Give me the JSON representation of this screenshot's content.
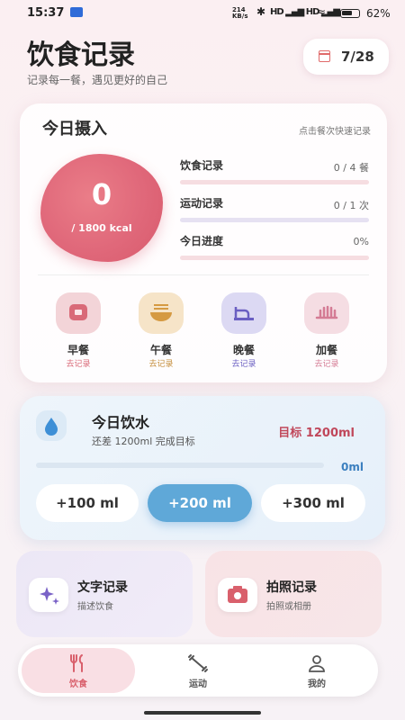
{
  "status": {
    "time": "15:37",
    "net_top": "214",
    "net_bottom": "KB/s",
    "battery": "62%",
    "bluetooth": "✱",
    "signal": "HD ▂▄▆ HD ▂▄▆",
    "wifi": "≈"
  },
  "header": {
    "title": "饮食记录",
    "subtitle": "记录每一餐，遇见更好的自己",
    "date": "7/28"
  },
  "intake": {
    "title": "今日摄入",
    "hint": "点击餐次快速记录",
    "calories": "0",
    "calorie_target": "/ 1800 kcal",
    "rows": [
      {
        "label": "饮食记录",
        "value": "0 / 4 餐"
      },
      {
        "label": "运动记录",
        "value": "0 / 1 次"
      },
      {
        "label": "今日进度",
        "value": "0%"
      }
    ],
    "meals": [
      {
        "name": "早餐",
        "action": "去记录",
        "icon": "toast-icon",
        "color": "#f3d4d8",
        "accent": "#d96a78"
      },
      {
        "name": "午餐",
        "action": "去记录",
        "icon": "noodle-bowl-icon",
        "color": "#f6e4c8",
        "accent": "#d59a42"
      },
      {
        "name": "晚餐",
        "action": "去记录",
        "icon": "dinner-plate-icon",
        "color": "#dcd9f3",
        "accent": "#6a5fc2"
      },
      {
        "name": "加餐",
        "action": "去记录",
        "icon": "snack-icon",
        "color": "#f5dde3",
        "accent": "#d47b94"
      }
    ]
  },
  "water": {
    "title": "今日饮水",
    "subtitle": "还差 1200ml 完成目标",
    "goal": "目标 1200ml",
    "current": "0ml",
    "progress": 0,
    "buttons": [
      "+100 ml",
      "+200 ml",
      "+300 ml"
    ]
  },
  "quick": [
    {
      "title": "文字记录",
      "desc": "描述饮食",
      "icon": "sparkle-icon"
    },
    {
      "title": "拍照记录",
      "desc": "拍照或相册",
      "icon": "camera-icon"
    }
  ],
  "nav": [
    {
      "label": "饮食",
      "icon": "fork-knife-icon"
    },
    {
      "label": "运动",
      "icon": "dumbbell-icon"
    },
    {
      "label": "我的",
      "icon": "person-icon"
    }
  ]
}
